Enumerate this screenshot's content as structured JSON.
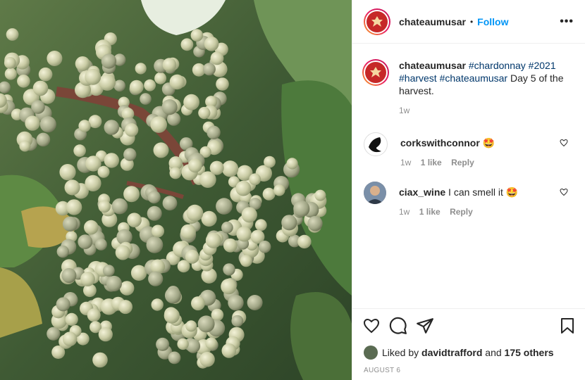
{
  "post": {
    "username": "chateaumusar",
    "separator": "•",
    "follow_label": "Follow",
    "more_label": "•••"
  },
  "caption": {
    "username": "chateaumusar",
    "tags": [
      "#chardonnay",
      "#2021",
      "#harvest",
      "#chateaumusar"
    ],
    "text": "Day 5 of the harvest.",
    "time": "1w"
  },
  "comments": [
    {
      "username": "corkswithconnor",
      "text": "🤩",
      "time": "1w",
      "likes": "1 like",
      "reply": "Reply"
    },
    {
      "username": "ciax_wine",
      "text": "I can smell it 🤩",
      "time": "1w",
      "likes": "1 like",
      "reply": "Reply"
    }
  ],
  "likes": {
    "prefix": "Liked by",
    "user": "davidtrafford",
    "connector": "and",
    "others": "175 others"
  },
  "date": "AUGUST 6",
  "icons": [
    "heart-icon",
    "comment-icon",
    "share-icon",
    "bookmark-icon"
  ],
  "colors": {
    "follow": "#0095f6",
    "hashtag": "#00376b",
    "muted": "#8e8e8e"
  }
}
